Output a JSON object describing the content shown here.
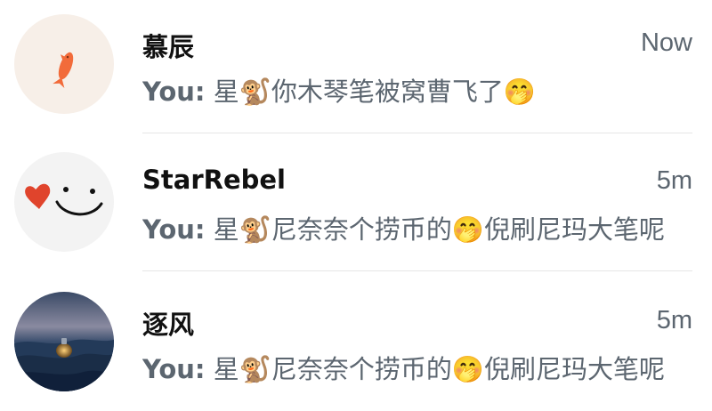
{
  "conversations": [
    {
      "name": "慕辰",
      "time": "Now",
      "sender": "You:",
      "message": "星🐒你木琴笔被窝曹飞了🤭",
      "avatar_icon": "fish-icon"
    },
    {
      "name": "StarRebel",
      "time": "5m",
      "sender": "You:",
      "message": "星🐒尼奈奈个捞币的🤭倪刷尼玛大笔呢",
      "avatar_icon": "heart-smiley-icon"
    },
    {
      "name": "逐风",
      "time": "5m",
      "sender": "You:",
      "message": "星🐒尼奈奈个捞币的🤭倪刷尼玛大笔呢",
      "avatar_icon": "ocean-bottle-icon"
    }
  ],
  "colors": {
    "name": "#111111",
    "secondary_text": "#5c6670",
    "divider": "#e6e6e6"
  }
}
